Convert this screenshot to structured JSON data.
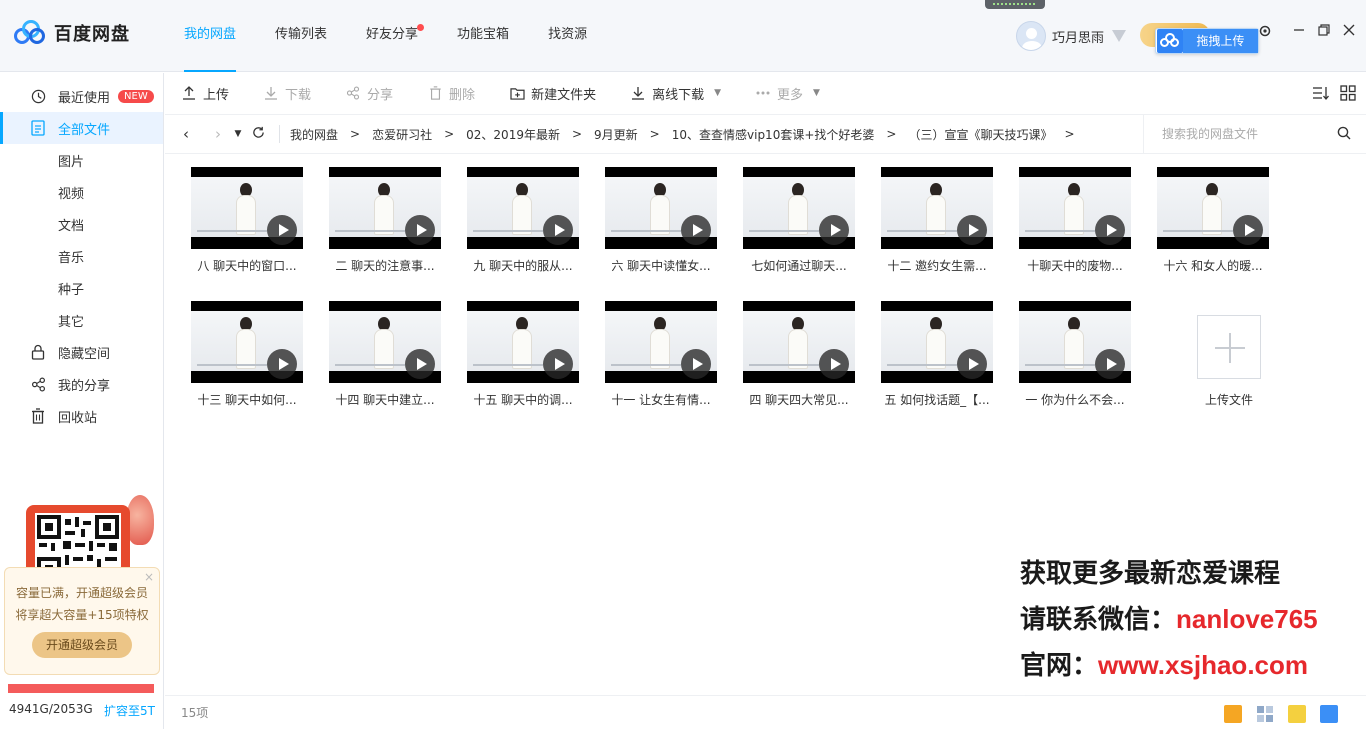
{
  "app": {
    "logo_text": "百度网盘",
    "nav": [
      {
        "label": "我的网盘"
      },
      {
        "label": "传输列表"
      },
      {
        "label": "好友分享"
      },
      {
        "label": "功能宝箱"
      },
      {
        "label": "找资源"
      }
    ],
    "username": "巧月思雨",
    "drag_upload_label": "拖拽上传",
    "accent_color": "#06a7ff"
  },
  "sidebar": {
    "items": [
      {
        "label": "最近使用",
        "badge": "NEW",
        "icon": "clock-icon"
      },
      {
        "label": "全部文件",
        "icon": "file-list-icon"
      },
      {
        "label": "图片"
      },
      {
        "label": "视频"
      },
      {
        "label": "文档"
      },
      {
        "label": "音乐"
      },
      {
        "label": "种子"
      },
      {
        "label": "其它"
      },
      {
        "label": "隐藏空间",
        "icon": "lock-icon"
      },
      {
        "label": "我的分享",
        "icon": "share-icon"
      },
      {
        "label": "回收站",
        "icon": "trash-icon"
      }
    ],
    "promo": {
      "line1": "容量已满，开通超级会员",
      "line2": "将享超大容量+15项特权",
      "button": "开通超级会员",
      "close": "×"
    },
    "quota": {
      "used_text": "4941G/2053G",
      "expand_label": "扩容至5T",
      "fill_fraction": 1.0
    }
  },
  "toolbar": {
    "upload": "上传",
    "download": "下载",
    "share": "分享",
    "delete": "删除",
    "new_folder": "新建文件夹",
    "offline_download": "离线下载",
    "more": "更多"
  },
  "path": {
    "crumbs": [
      "我的网盘",
      "恋爱研习社",
      "02、2019年最新",
      "9月更新",
      "10、查查情感vip10套课+找个好老婆",
      "（三）宣宣《聊天技巧课》"
    ],
    "separator": ">",
    "search_placeholder": "搜索我的网盘文件"
  },
  "files": [
    {
      "name": "八 聊天中的窗口..."
    },
    {
      "name": "二 聊天的注意事..."
    },
    {
      "name": "九 聊天中的服从..."
    },
    {
      "name": "六 聊天中读懂女..."
    },
    {
      "name": "七如何通过聊天..."
    },
    {
      "name": "十二 邀约女生需..."
    },
    {
      "name": "十聊天中的废物..."
    },
    {
      "name": "十六 和女人的暧..."
    },
    {
      "name": "十三 聊天中如何..."
    },
    {
      "name": "十四 聊天中建立..."
    },
    {
      "name": "十五 聊天中的调..."
    },
    {
      "name": "十一 让女生有情..."
    },
    {
      "name": "四 聊天四大常见..."
    },
    {
      "name": "五 如何找话题_【..."
    },
    {
      "name": "一 你为什么不会..."
    }
  ],
  "upload_tile_label": "上传文件",
  "watermark": {
    "line1": "获取更多最新恋爱课程",
    "line2_prefix": "请联系微信：",
    "line2_value": "nanlove765",
    "line3_prefix": "官网：",
    "line3_value": "www.xsjhao.com"
  },
  "status": {
    "count": "15项"
  }
}
